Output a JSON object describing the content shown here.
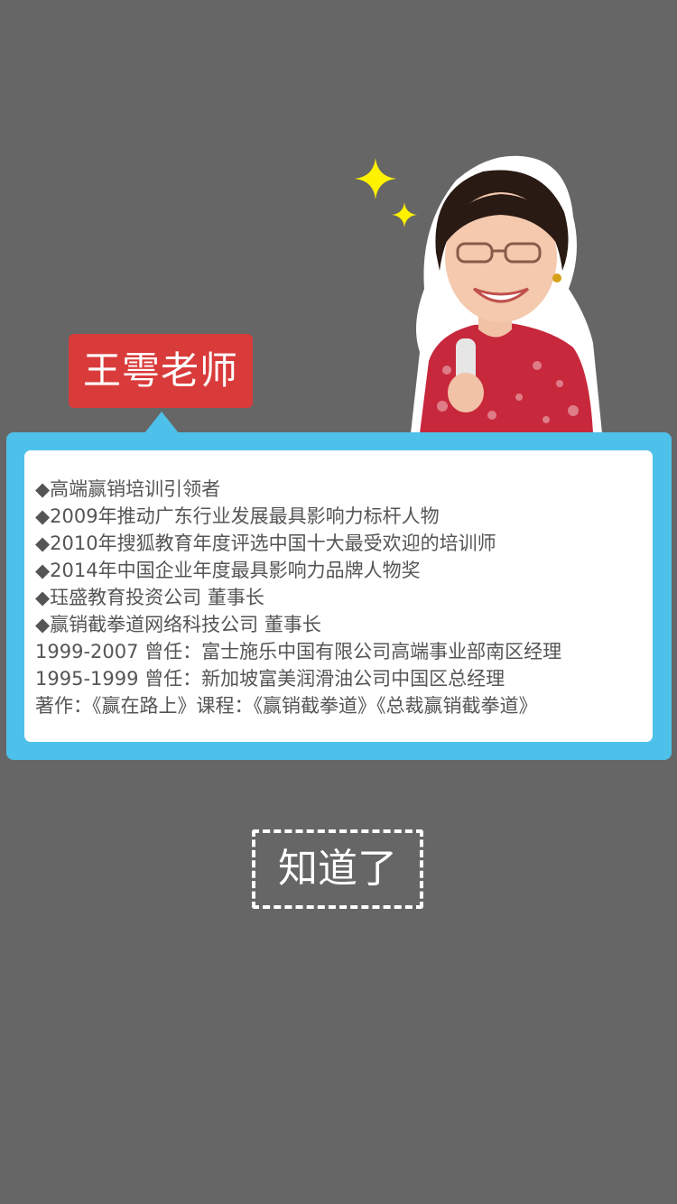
{
  "profile": {
    "name": "王雩老师",
    "portrait_icon": "teacher-portrait",
    "sparkle_icon": "sparkle-icon",
    "colors": {
      "background": "#666666",
      "name_tag": "#d93b3b",
      "card_frame": "#4ec1ea",
      "card_text": "#555555",
      "sparkle": "#fff200"
    }
  },
  "info": {
    "lines": [
      "◆高端赢销培训引领者",
      "◆2009年推动广东行业发展最具影响力标杆人物",
      "◆2010年搜狐教育年度评选中国十大最受欢迎的培训师",
      "◆2014年中国企业年度最具影响力品牌人物奖",
      "◆珏盛教育投资公司 董事长",
      "◆赢销截拳道网络科技公司 董事长",
      "1999-2007 曾任：富士施乐中国有限公司高端事业部南区经理",
      "1995-1999 曾任：新加坡富美润滑油公司中国区总经理",
      "著作：《赢在路上》课程：《赢销截拳道》《总裁赢销截拳道》"
    ]
  },
  "actions": {
    "confirm_label": "知道了"
  }
}
